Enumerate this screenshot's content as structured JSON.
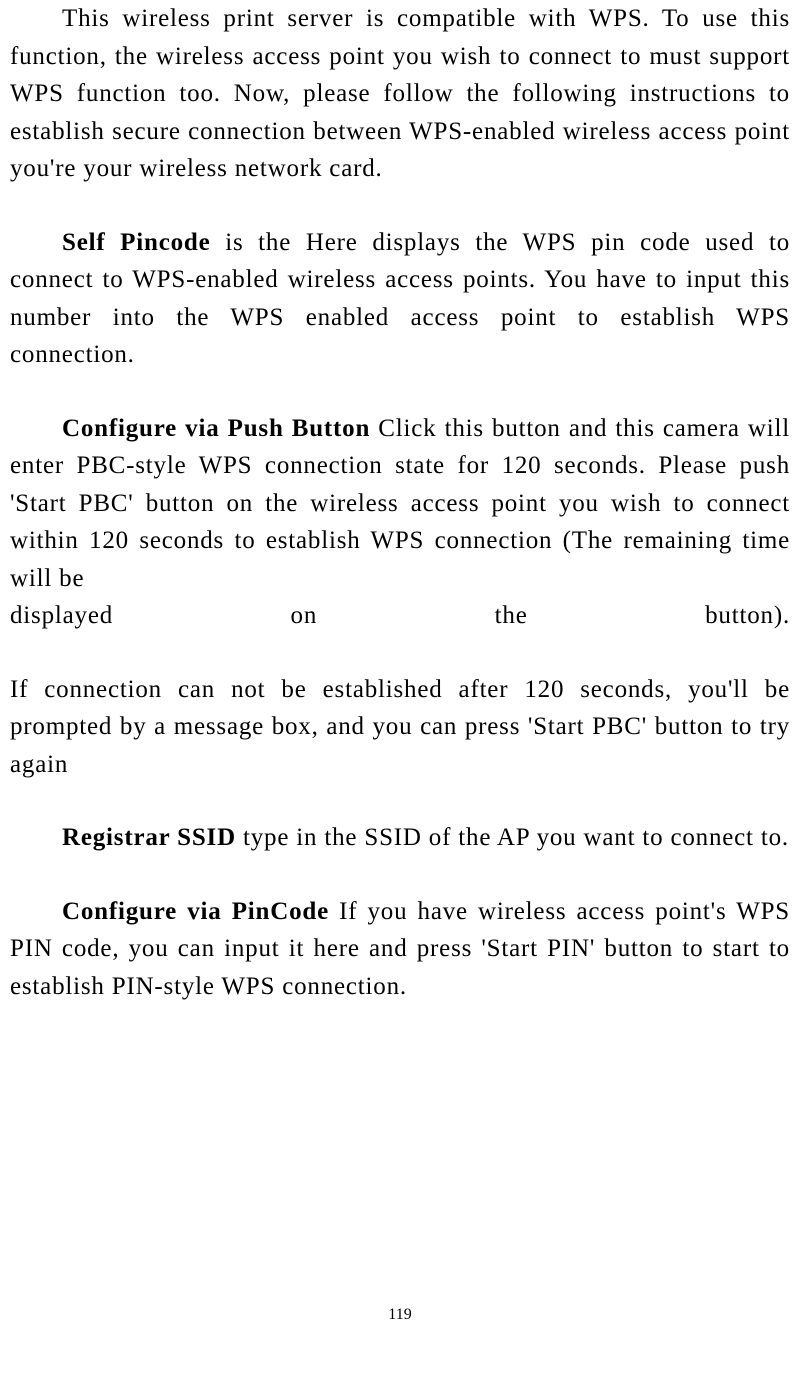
{
  "paragraphs": {
    "p1_text": "This wireless print server is compatible with WPS. To use this function, the wireless access point you wish to connect to must support WPS function too. Now, please follow the following instructions to establish secure connection between WPS-enabled wireless access point you're your wireless network card.",
    "p2_bold": "Self Pincode",
    "p2_text": " is the Here displays the WPS pin code used to connect to WPS-enabled wireless access points. You have to input this number into the WPS enabled access point to establish WPS connection.",
    "p3_bold": "Configure via Push Button",
    "p3_text_a": " Click this button and this camera will enter PBC-style WPS connection state for 120 seconds. Please push 'Start PBC' button on the wireless access point you wish to connect within 120 seconds to establish WPS connection (The remaining time will be ",
    "p3_text_b": "displayed on the button).",
    "p4_text": "If connection can not be established after 120 seconds, you'll be prompted by a message box, and you can press 'Start PBC' button to try again",
    "p5_bold": "Registrar SSID",
    "p5_text": " type in the SSID of the AP you want to connect to.",
    "p6_bold": "Configure via PinCode",
    "p6_text": " If you have wireless access point's WPS PIN code, you can input it here and press 'Start PIN' button to start to establish PIN-style WPS connection."
  },
  "page_number": "119"
}
